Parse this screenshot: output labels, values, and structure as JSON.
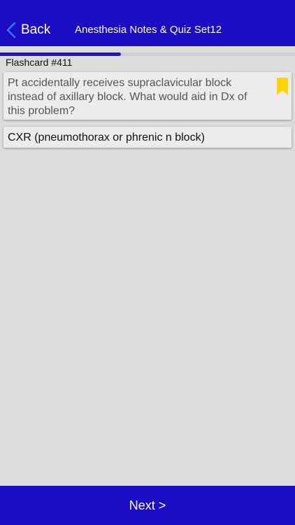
{
  "navbar": {
    "back_label": "Back",
    "title": "Anesthesia Notes & Quiz Set12",
    "bg_color": "#1c0cc4"
  },
  "progress": {
    "fraction": 0.41
  },
  "flashcard": {
    "number_label": "Flashcard #411",
    "question": "Pt accidentally receives supraclavicular block instead of axillary block. What would aid in Dx of this problem?",
    "answer": "CXR (pneumothorax or phrenic n block)",
    "bookmark_icon": "bookmark-icon",
    "bookmark_color": "#ffd400"
  },
  "footer": {
    "next_label": "Next >"
  }
}
